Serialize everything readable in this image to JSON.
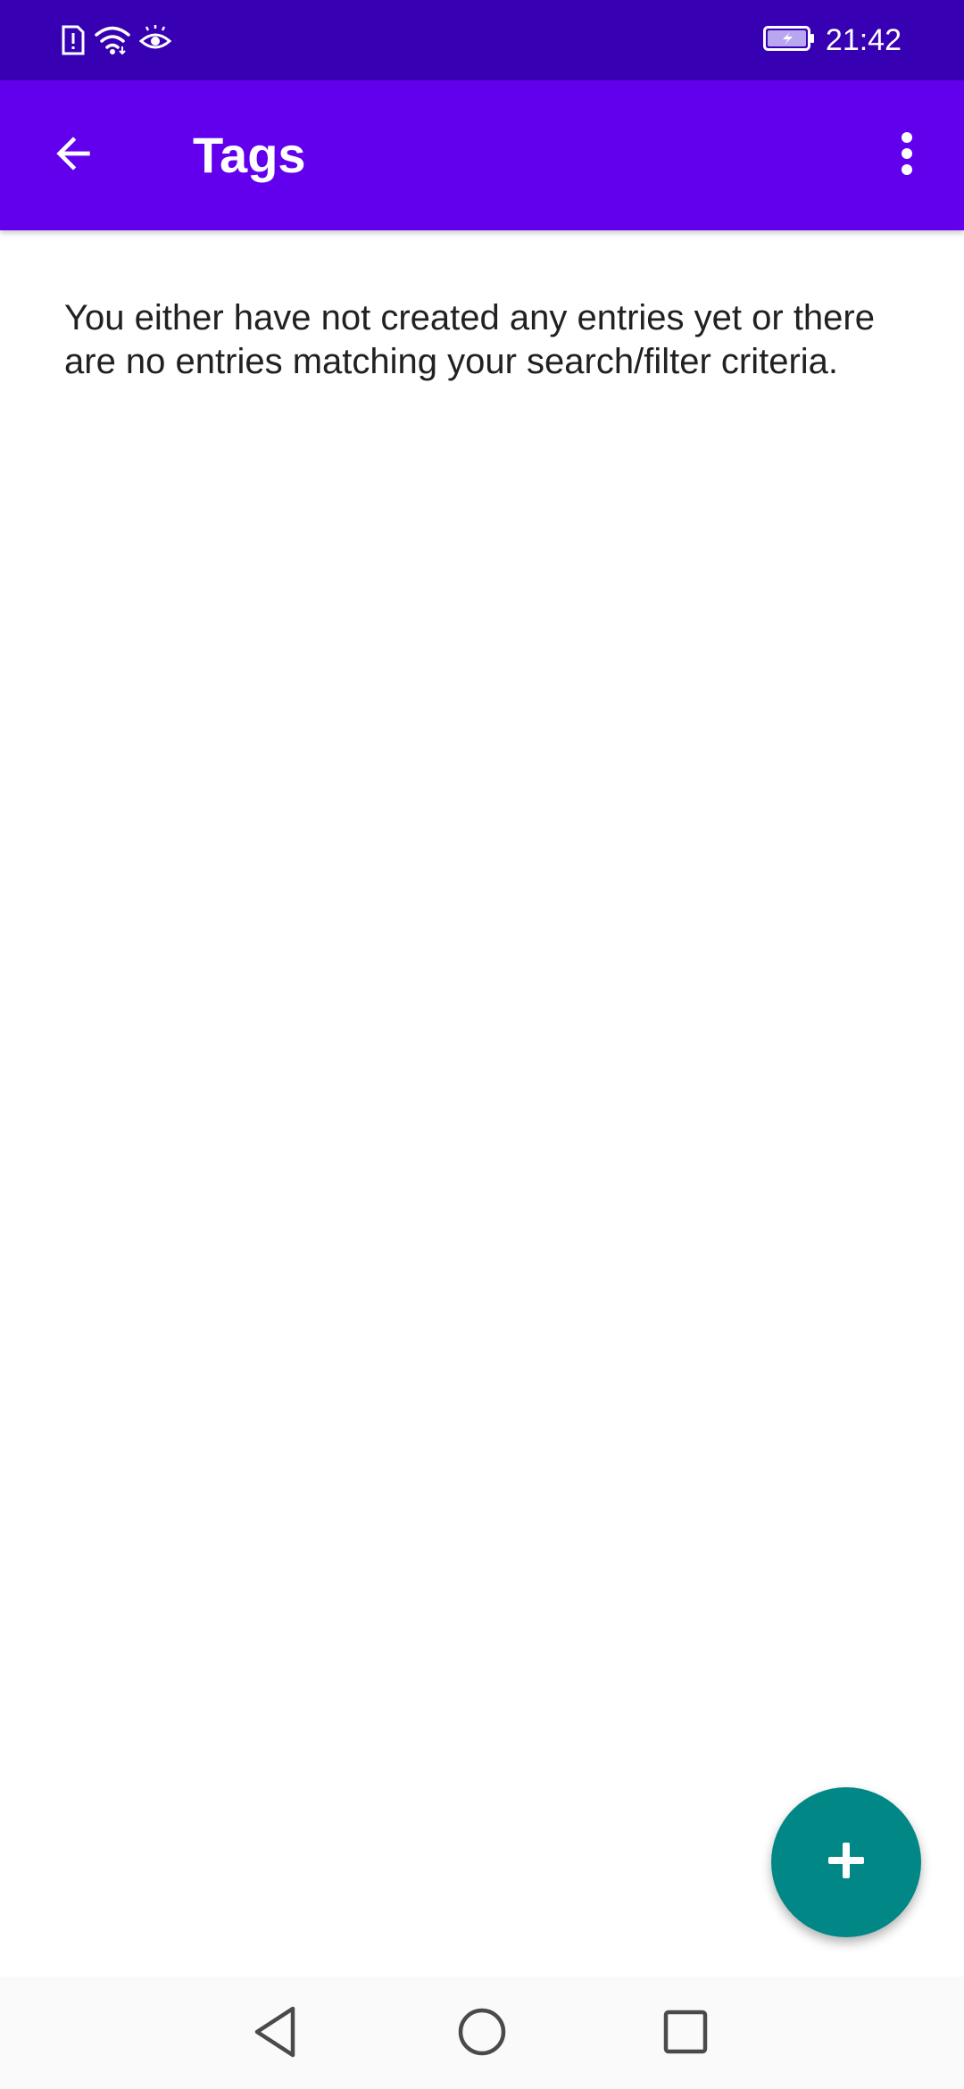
{
  "status_bar": {
    "time": "21:42",
    "icons": [
      "sim-alert-icon",
      "wifi-icon",
      "eye-icon",
      "battery-charging-icon"
    ]
  },
  "app_bar": {
    "title": "Tags",
    "back_icon": "arrow-back-icon",
    "menu_icon": "more-vert-icon"
  },
  "content": {
    "empty_message": "You either have not created any entries yet or there are no entries matching your search/filter criteria."
  },
  "fab": {
    "icon": "add-icon"
  },
  "nav_bar": {
    "icons": [
      "back-triangle-icon",
      "home-circle-icon",
      "recents-square-icon"
    ]
  },
  "colors": {
    "status_bar": "#3700b3",
    "app_bar": "#6200ee",
    "fab": "#018786",
    "text": "#212121",
    "background": "#ffffff"
  }
}
